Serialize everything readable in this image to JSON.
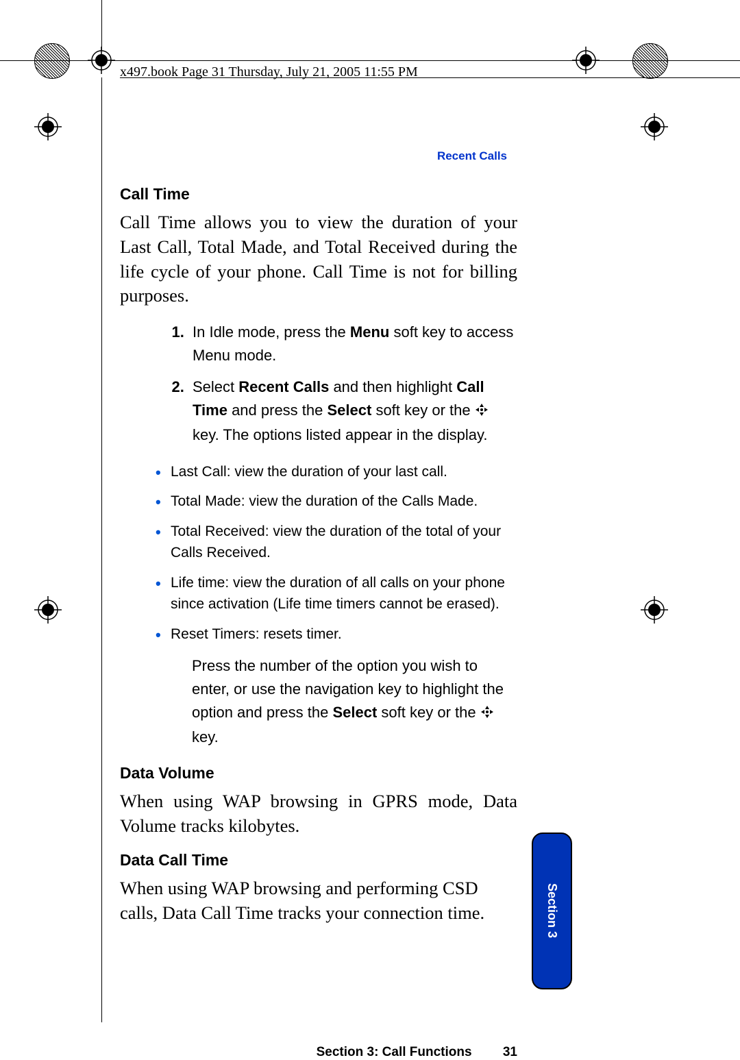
{
  "header": {
    "text": "x497.book  Page 31  Thursday, July 21, 2005  11:55 PM"
  },
  "running_head": "Recent Calls",
  "sections": {
    "call_time": {
      "heading": "Call Time",
      "body": "Call Time allows you to view the duration of your Last Call, Total Made, and Total Received during the life cycle of your phone. Call Time is not for billing purposes.",
      "steps": {
        "s1_a": "In Idle mode, press the ",
        "s1_b": "Menu",
        "s1_c": " soft key to access Menu mode.",
        "s2_a": "Select ",
        "s2_b": "Recent Calls",
        "s2_c": " and then highlight ",
        "s2_d": "Call Time",
        "s2_e": " and press the ",
        "s2_f": "Select",
        "s2_g": " soft key or the ",
        "s2_h": " key. The options listed appear in the display."
      },
      "bullets": {
        "b1": "Last Call: view the duration of your last call.",
        "b2": "Total Made: view the duration of the Calls Made.",
        "b3": "Total Received: view the duration of the total of your Calls Received.",
        "b4": "Life time: view the duration of all calls on your phone since activation (Life time timers cannot be erased).",
        "b5": "Reset Timers: resets timer."
      },
      "after_a": "Press the number of the option you wish to enter, or use the navigation key to highlight the option and press the ",
      "after_b": "Select",
      "after_c": " soft key or the ",
      "after_d": " key."
    },
    "data_volume": {
      "heading": "Data Volume",
      "body": "When using WAP browsing in GPRS mode, Data Volume tracks kilobytes."
    },
    "data_call_time": {
      "heading": "Data Call Time",
      "body": "When using WAP browsing and performing CSD calls, Data Call Time tracks your connection time."
    }
  },
  "tab": "Section 3",
  "footer": {
    "section": "Section 3: Call Functions",
    "page": "31"
  }
}
